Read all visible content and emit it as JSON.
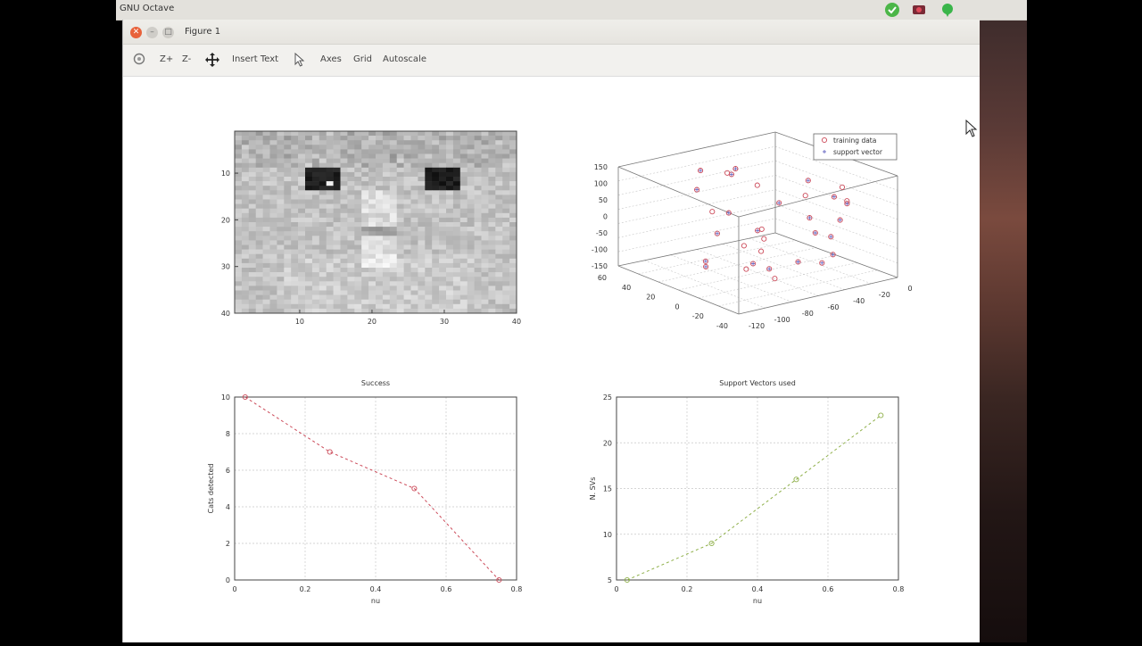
{
  "app": {
    "title": "GNU Octave"
  },
  "window": {
    "title": "Figure 1"
  },
  "toolbar": {
    "zoom_in": "Z+",
    "zoom_out": "Z-",
    "insert_text": "Insert Text",
    "axes": "Axes",
    "grid": "Grid",
    "autoscale": "Autoscale"
  },
  "icons": [
    "rotate-icon",
    "pan-icon",
    "select-arrow-icon",
    "close-icon",
    "minimize-icon",
    "maximize-icon",
    "check-icon",
    "record-icon",
    "chat-icon"
  ],
  "colors": {
    "series_red": "#cc4b5a",
    "series_blue": "#6a6ac4",
    "series_green": "#8fb04a",
    "grid": "#c8c8c8"
  },
  "chart_data": [
    {
      "type": "heatmap",
      "title": "",
      "colormap": "gray",
      "xticks": [
        "10",
        "20",
        "30",
        "40"
      ],
      "yticks": [
        "10",
        "20",
        "30",
        "40"
      ],
      "xlim": [
        1,
        40
      ],
      "ylim": [
        1,
        40
      ]
    },
    {
      "type": "scatter",
      "title": "",
      "zticks": [
        "150",
        "100",
        "50",
        "0",
        "-50",
        "-100",
        "-150"
      ],
      "xticks": [
        "-120",
        "-100",
        "-80",
        "-60",
        "-40",
        "-20",
        "0"
      ],
      "yticks": [
        "60",
        "40",
        "20",
        "0",
        "-20",
        "-40"
      ],
      "legend": [
        {
          "label": "training data",
          "marker": "o"
        },
        {
          "label": "support vector",
          "marker": "+"
        }
      ],
      "legend_position": "top-right"
    },
    {
      "type": "line",
      "title": "Success",
      "xlabel": "nu",
      "ylabel": "Cats detected",
      "xlim": [
        0,
        0.8
      ],
      "ylim": [
        0,
        10
      ],
      "xticks": [
        "0",
        "0.2",
        "0.4",
        "0.6",
        "0.8"
      ],
      "yticks": [
        "0",
        "2",
        "4",
        "6",
        "8",
        "10"
      ],
      "grid": true,
      "series": [
        {
          "x": [
            0.03,
            0.27,
            0.51,
            0.75
          ],
          "y": [
            10,
            7,
            5,
            0
          ]
        }
      ]
    },
    {
      "type": "line",
      "title": "Support Vectors used",
      "xlabel": "nu",
      "ylabel": "N. SVs",
      "xlim": [
        0,
        0.8
      ],
      "ylim": [
        5,
        25
      ],
      "xticks": [
        "0",
        "0.2",
        "0.4",
        "0.6",
        "0.8"
      ],
      "yticks": [
        "5",
        "10",
        "15",
        "20",
        "25"
      ],
      "grid": true,
      "series": [
        {
          "x": [
            0.03,
            0.27,
            0.51,
            0.75
          ],
          "y": [
            5,
            9,
            16,
            23
          ]
        }
      ]
    }
  ]
}
